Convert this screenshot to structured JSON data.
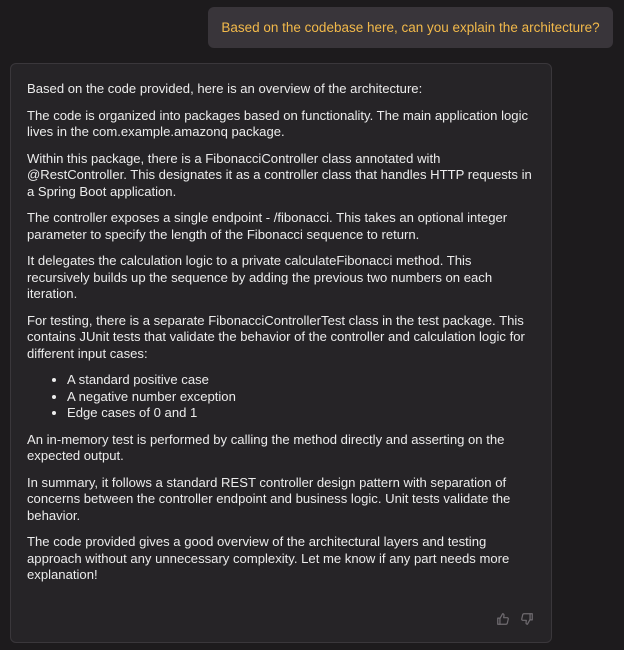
{
  "user_message": {
    "text": "Based on the codebase here, can you explain the architecture?"
  },
  "assistant_message": {
    "paragraphs": [
      "Based on the code provided, here is an overview of the architecture:",
      "The code is organized into packages based on functionality. The main application logic lives in the com.example.amazonq package.",
      "Within this package, there is a FibonacciController class annotated with @RestController. This designates it as a controller class that handles HTTP requests in a Spring Boot application.",
      "The controller exposes a single endpoint - /fibonacci. This takes an optional integer parameter to specify the length of the Fibonacci sequence to return.",
      "It delegates the calculation logic to a private calculateFibonacci method. This recursively builds up the sequence by adding the previous two numbers on each iteration.",
      "For testing, there is a separate FibonacciControllerTest class in the test package. This contains JUnit tests that validate the behavior of the controller and calculation logic for different input cases:"
    ],
    "bullets": [
      "A standard positive case",
      "A negative number exception",
      "Edge cases of 0 and 1"
    ],
    "closing_paragraphs": [
      "An in-memory test is performed by calling the method directly and asserting on the expected output.",
      "In summary, it follows a standard REST controller design pattern with separation of concerns between the controller endpoint and business logic. Unit tests validate the behavior.",
      "The code provided gives a good overview of the architectural layers and testing approach without any unnecessary complexity. Let me know if any part needs more explanation!"
    ],
    "feedback": {
      "thumbs_up_icon": "thumbs-up-icon",
      "thumbs_down_icon": "thumbs-down-icon"
    }
  },
  "colors": {
    "background": "#1d1b1d",
    "user_bubble": "#39353a",
    "user_text": "#f2b94a",
    "card_background": "#262427",
    "card_border": "#3a373b",
    "body_text": "#ececec",
    "icon": "#6f6b70"
  }
}
